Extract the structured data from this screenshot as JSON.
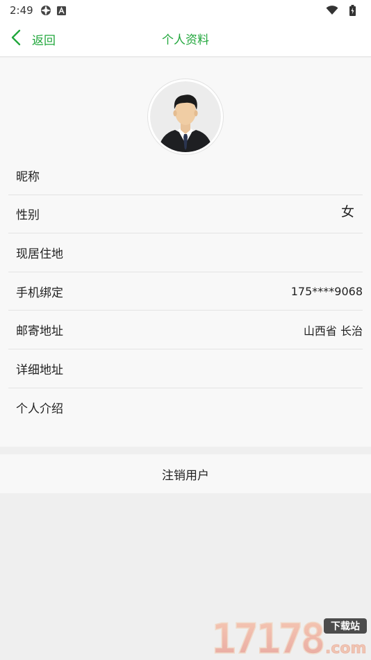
{
  "status_bar": {
    "time": "2:49",
    "left_icons": [
      "settings-icon",
      "a-icon"
    ],
    "right_icons": [
      "wifi-icon",
      "battery-icon"
    ]
  },
  "header": {
    "back_label": "返回",
    "title": "个人资料",
    "accent": "#21a73c"
  },
  "avatar": {
    "icon": "person-avatar-icon"
  },
  "fields": [
    {
      "label": "昵称",
      "value": ""
    },
    {
      "label": "性别",
      "value": "女"
    },
    {
      "label": "现居住地",
      "value": ""
    },
    {
      "label": "手机绑定",
      "value": "175****9068"
    },
    {
      "label": "邮寄地址",
      "value": "山西省 长治"
    },
    {
      "label": "详细地址",
      "value": ""
    },
    {
      "label": "个人介绍",
      "value": ""
    }
  ],
  "actions": {
    "cancel_account": "注销用户"
  },
  "watermark": {
    "number": "17178",
    "tag": "下载站",
    "domain": ".com"
  }
}
